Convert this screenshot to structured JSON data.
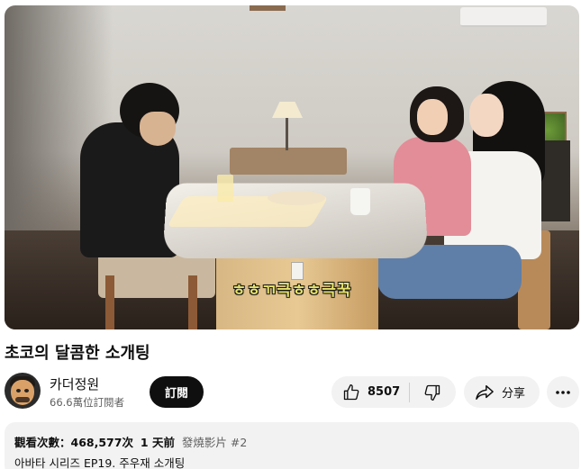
{
  "video": {
    "caption": "ㅎㅎㄲ극ㅎㅎ극꾹"
  },
  "title": "초코의 달콤한 소개팅",
  "channel": {
    "name": "카더정원",
    "subscribers": "66.6萬位訂閱者",
    "subscribe_label": "訂閱",
    "avatar_icon": "channel-avatar"
  },
  "actions": {
    "like_count": "8507",
    "like_icon": "thumbs-up-icon",
    "dislike_icon": "thumbs-down-icon",
    "share_label": "分享",
    "share_icon": "share-arrow-icon",
    "more_icon": "more-horizontal-icon"
  },
  "description": {
    "views_label": "觀看次數：",
    "views_value": "468,577次",
    "date": "1 天前",
    "tag_label": "發燒影片",
    "tag_value": "#2",
    "line1": "아바타 시리즈 EP19. 주우재 소개팅"
  },
  "colors": {
    "subscribe_bg": "#0f0f0f",
    "pill_bg": "#f2f2f2",
    "caption_text": "#e6e36a"
  }
}
